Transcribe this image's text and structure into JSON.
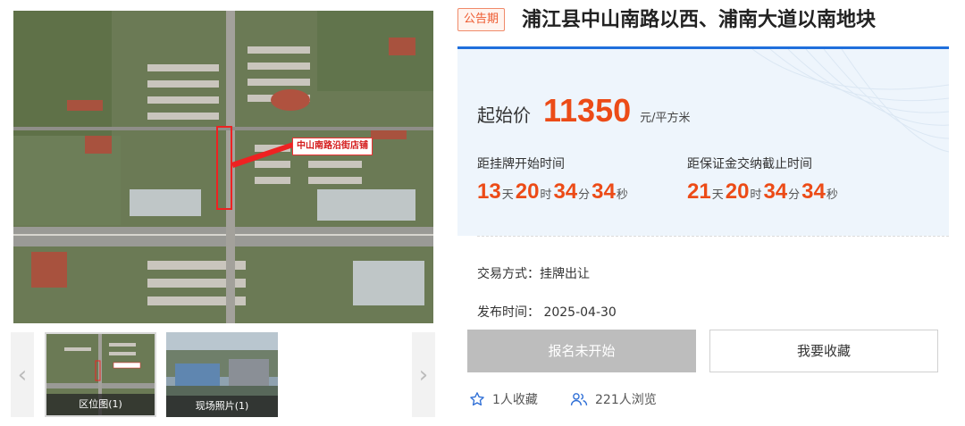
{
  "gallery": {
    "map_label": "中山南路沿街店铺",
    "thumbnails": [
      {
        "caption": "区位图(1)"
      },
      {
        "caption": "现场照片(1)"
      }
    ],
    "prev_icon": "chevron-left-icon",
    "next_icon": "chevron-right-icon"
  },
  "header": {
    "status_tag": "公告期",
    "title": "浦江县中山南路以西、浦南大道以南地块"
  },
  "price": {
    "label": "起始价",
    "value": "11350",
    "unit": "元/平方米"
  },
  "countdowns": [
    {
      "label": "距挂牌开始时间",
      "days": "13",
      "hours": "20",
      "minutes": "34",
      "seconds": "34"
    },
    {
      "label": "距保证金交纳截止时间",
      "days": "21",
      "hours": "20",
      "minutes": "34",
      "seconds": "34"
    }
  ],
  "units": {
    "day": "天",
    "hour": "时",
    "minute": "分",
    "second": "秒"
  },
  "details": {
    "trade_mode": "交易方式：挂牌出让",
    "publish_label": "发布时间：",
    "publish_date": "2025-04-30"
  },
  "actions": {
    "signup_label": "报名未开始",
    "favorite_label": "我要收藏"
  },
  "stats": {
    "favorites": "1人收藏",
    "views": "221人浏览",
    "favorite_icon": "star-icon",
    "views_icon": "users-icon"
  },
  "colors": {
    "accent": "#ec4b17",
    "brand_blue": "#1f6fdc",
    "tag_border": "#f08a6a",
    "disabled_button": "#bdbdbd"
  }
}
